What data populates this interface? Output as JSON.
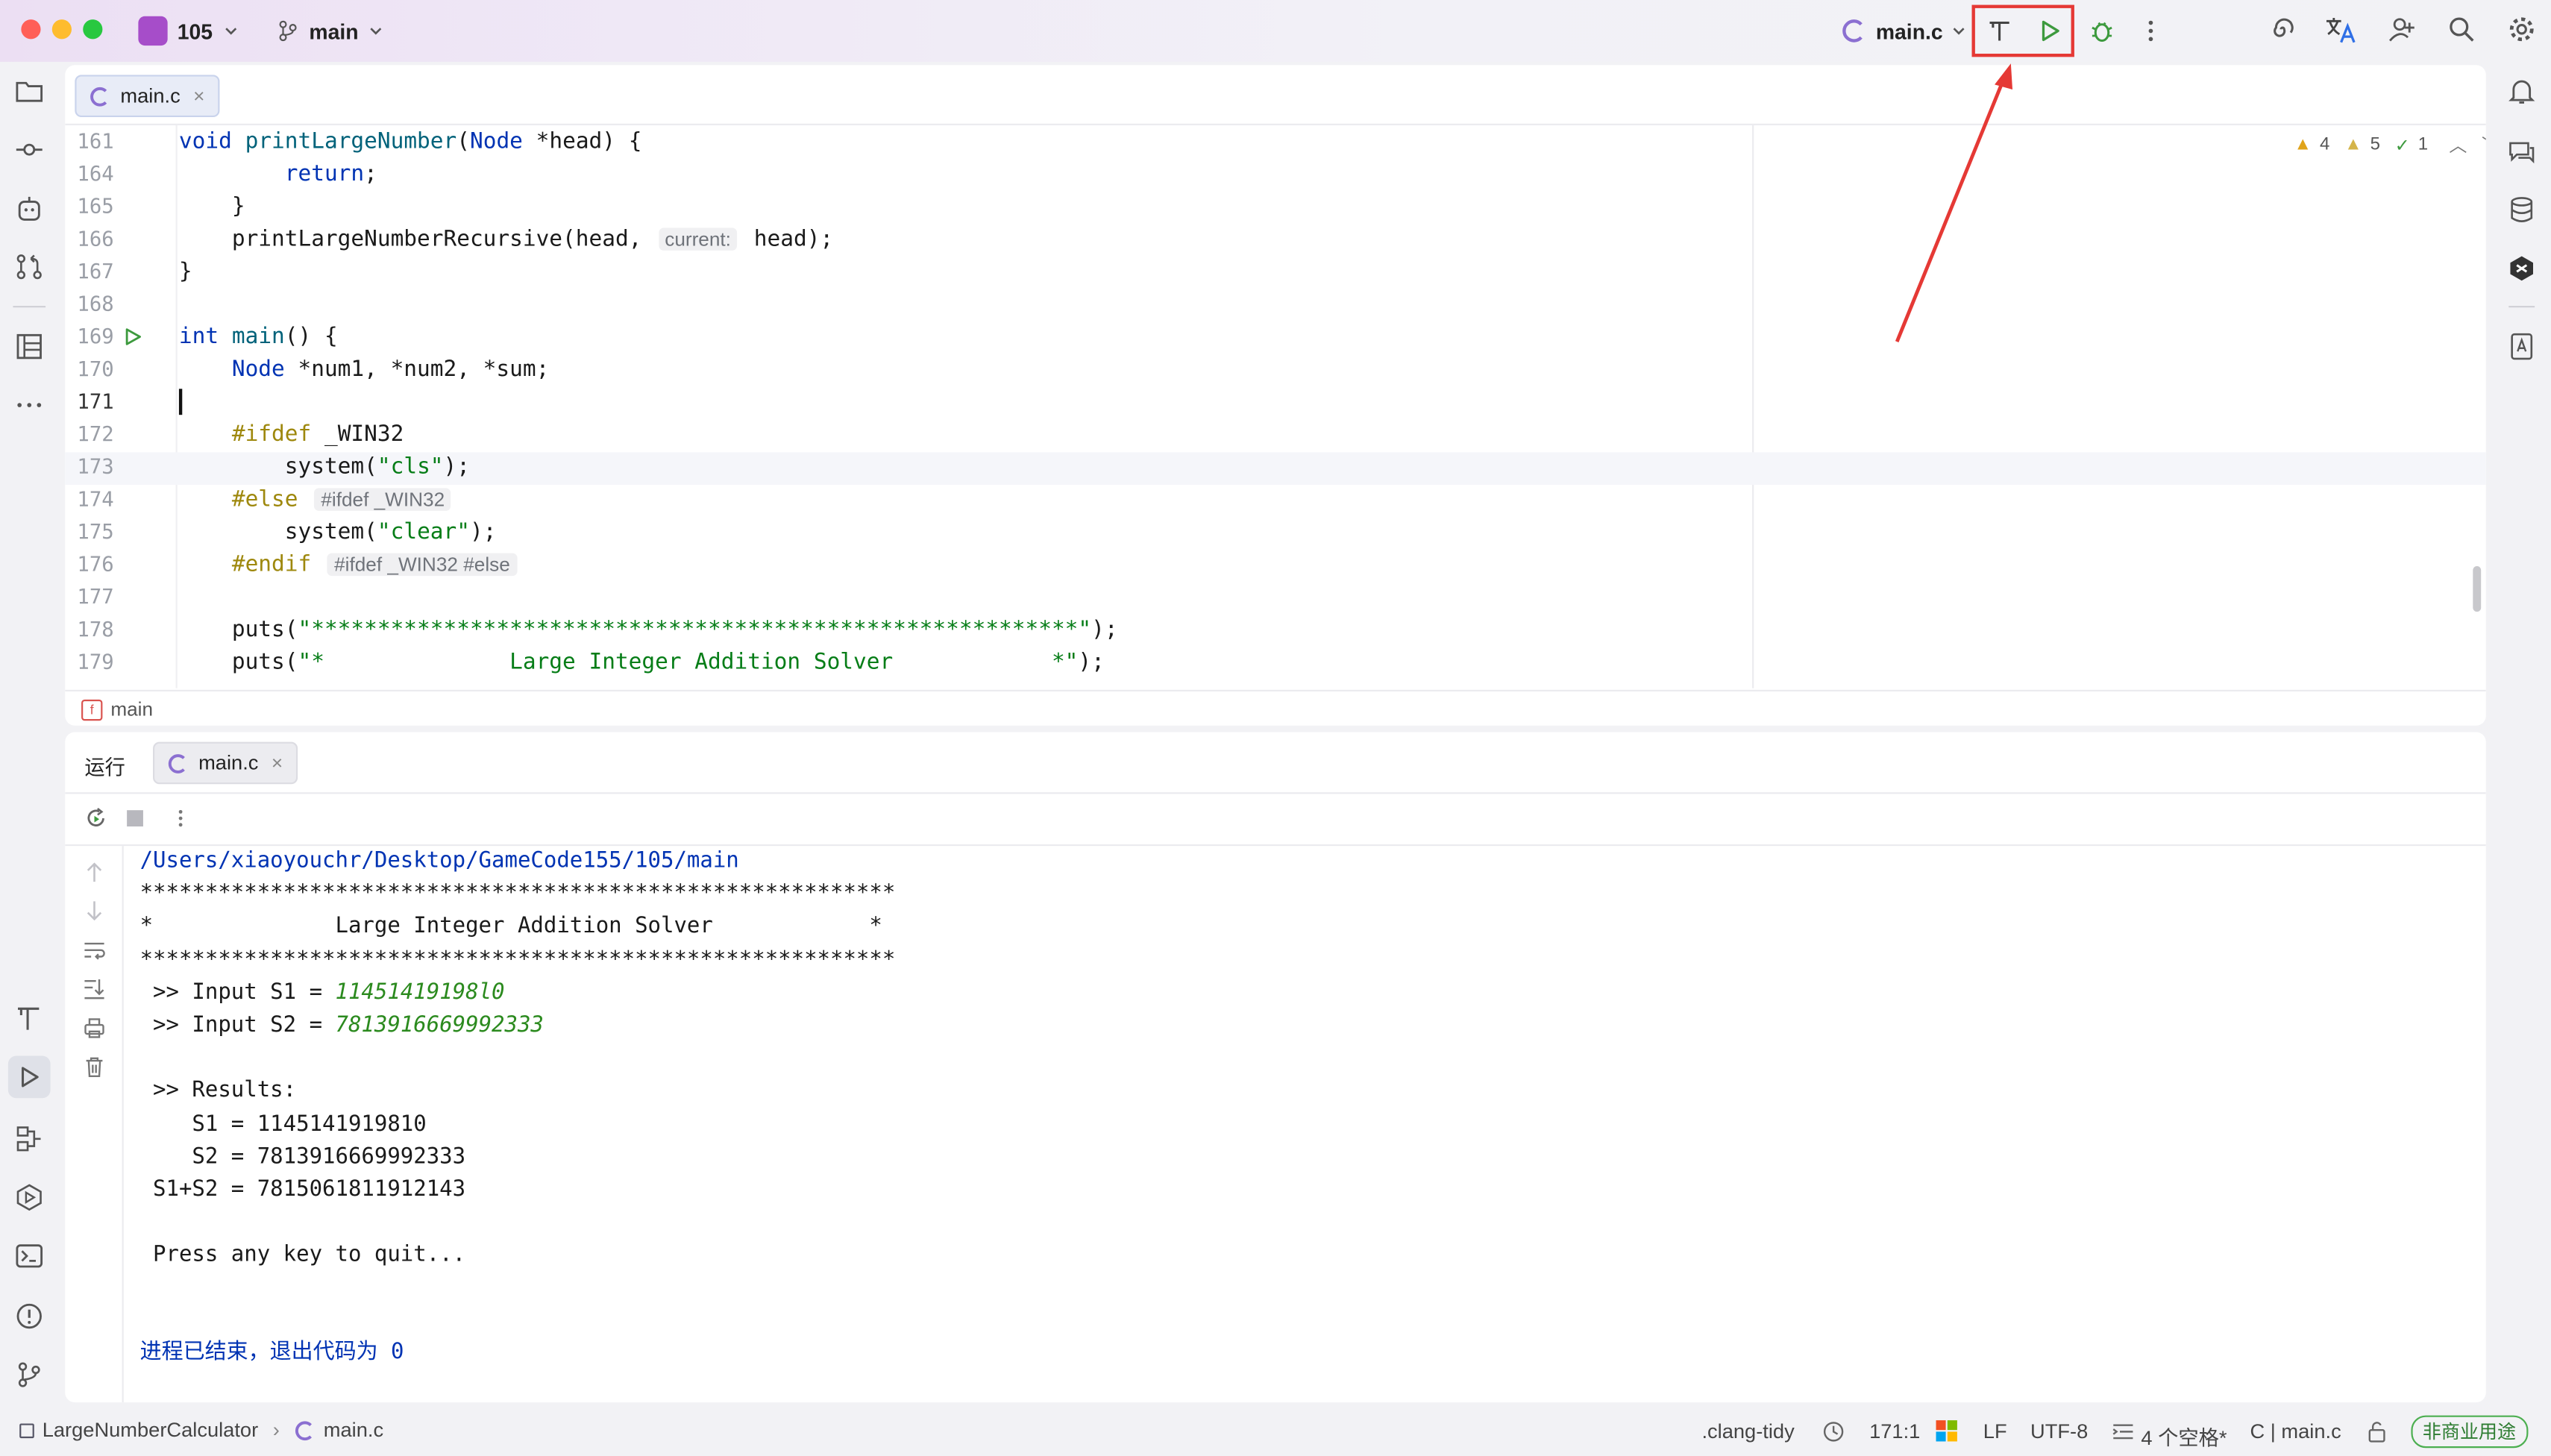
{
  "window": {
    "project_badge": "105",
    "project_name": "105",
    "branch": "main",
    "run_config": "main.c"
  },
  "editor": {
    "tab_label": "main.c",
    "inspections": {
      "warnings": "4",
      "weak_warnings": "5",
      "ok": "1"
    },
    "breadcrumb": "main",
    "line_numbers": [
      "161",
      "164",
      "165",
      "166",
      "167",
      "168",
      "169",
      "170",
      "171",
      "172",
      "173",
      "174",
      "175",
      "176",
      "177",
      "178",
      "179"
    ],
    "lines": {
      "l161_type": "void",
      "l161_fn": "printLargeNumber",
      "l161_rest_a": "(",
      "l161_node": "Node",
      "l161_rest_b": " *head) {",
      "l164_kw": "return",
      "l164_rest": ";",
      "l165": "}",
      "l166_a": "printLargeNumberRecursive(head, ",
      "l166_hint": "current:",
      "l166_b": " head);",
      "l167": "}",
      "l169_type": "int",
      "l169_fn": "main",
      "l169_rest": "() {",
      "l170_type": "Node",
      "l170_rest": " *num1, *num2, *sum;",
      "l172_dir": "#ifdef",
      "l172_macro": " _WIN32",
      "l173_a": "system(",
      "l173_str": "\"cls\"",
      "l173_b": ");",
      "l174_dir": "#else",
      "l174_hint": "#ifdef _WIN32",
      "l175_a": "system(",
      "l175_str": "\"clear\"",
      "l175_b": ");",
      "l176_dir": "#endif",
      "l176_hint": "#ifdef _WIN32 #else",
      "l178_a": "puts(",
      "l178_str": "\"**********************************************************\"",
      "l178_b": ");",
      "l179_a": "puts(",
      "l179_str": "\"*              Large Integer Addition Solver            *\"",
      "l179_b": ");"
    }
  },
  "run_panel": {
    "title": "运行",
    "tab_label": "main.c",
    "output": {
      "path": "/Users/xiaoyouchr/Desktop/GameCode155/105/main",
      "stars": "**********************************************************",
      "banner": "*              Large Integer Addition Solver            *",
      "input1_label": " >> Input S1 = ",
      "input1_value": "11451419198l0",
      "input2_label": " >> Input S2 = ",
      "input2_value": "7813916669992333",
      "results": " >> Results:",
      "s1": "    S1 = 1145141919810",
      "s2": "    S2 = 7813916669992333",
      "sum": " S1+S2 = 7815061811912143",
      "quit": " Press any key to quit...",
      "exit": "进程已结束，退出代码为 0"
    }
  },
  "statusbar": {
    "project": "LargeNumberCalculator",
    "file": "main.c",
    "linter": ".clang-tidy",
    "position": "171:1",
    "line_sep": "LF",
    "encoding": "UTF-8",
    "indent": "4 个空格*",
    "context": "C | main.c",
    "license": "非商业用途"
  },
  "colors": {
    "accent_highlight": "#e53935",
    "run_green": "#3d9a3e",
    "console_blue": "#0033b3"
  }
}
